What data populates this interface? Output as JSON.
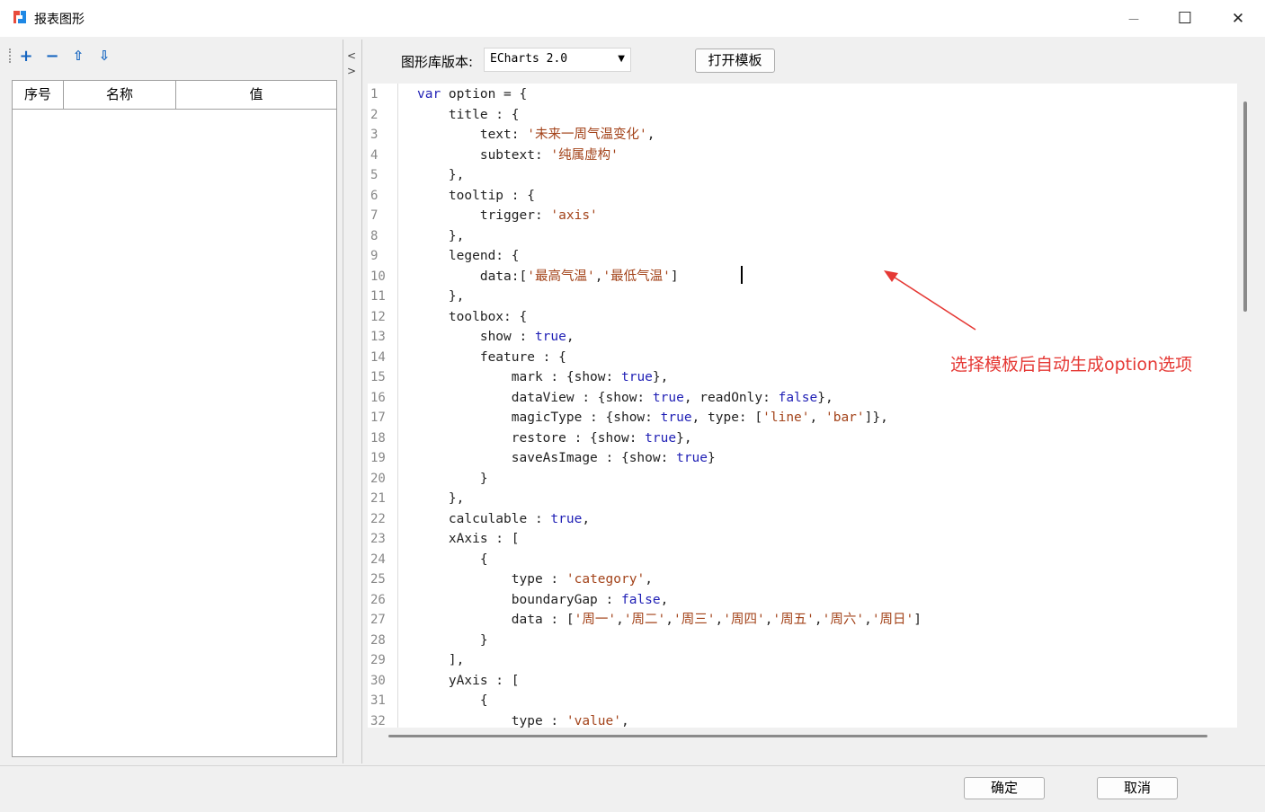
{
  "window": {
    "title": "报表图形",
    "minimize_glyph": "—",
    "maximize_glyph": "☐",
    "close_glyph": "✕"
  },
  "toolbar": {
    "icons": [
      "add-icon",
      "remove-icon",
      "move-up-icon",
      "move-down-icon"
    ],
    "add_glyph": "+",
    "remove_glyph": "−",
    "up_glyph": "⇧",
    "down_glyph": "⇩"
  },
  "params_table": {
    "columns": [
      "序号",
      "名称",
      "值"
    ],
    "rows": []
  },
  "splitter": {
    "left_glyph": "<",
    "right_glyph": ">"
  },
  "library": {
    "label": "图形库版本:",
    "selected": "ECharts 2.0",
    "arrow_glyph": "▼"
  },
  "open_template_label": "打开模板",
  "code_lines": [
    "var option = {",
    "    title : {",
    "        text: '未来一周气温变化',",
    "        subtext: '纯属虚构'",
    "    },",
    "    tooltip : {",
    "        trigger: 'axis'",
    "    },",
    "    legend: {",
    "        data:['最高气温','最低气温']",
    "    },",
    "    toolbox: {",
    "        show : true,",
    "        feature : {",
    "            mark : {show: true},",
    "            dataView : {show: true, readOnly: false},",
    "            magicType : {show: true, type: ['line', 'bar']},",
    "            restore : {show: true},",
    "            saveAsImage : {show: true}",
    "        }",
    "    },",
    "    calculable : true,",
    "    xAxis : [",
    "        {",
    "            type : 'category',",
    "            boundaryGap : false,",
    "            data : ['周一','周二','周三','周四','周五','周六','周日']",
    "        }",
    "    ],",
    "    yAxis : [",
    "        {",
    "            type : 'value',"
  ],
  "annotation": "选择模板后自动生成option选项",
  "buttons": {
    "ok": "确定",
    "cancel": "取消"
  },
  "colors": {
    "keyword": "#1f1fb5",
    "string": "#a3431a",
    "annotation": "#e53935"
  }
}
